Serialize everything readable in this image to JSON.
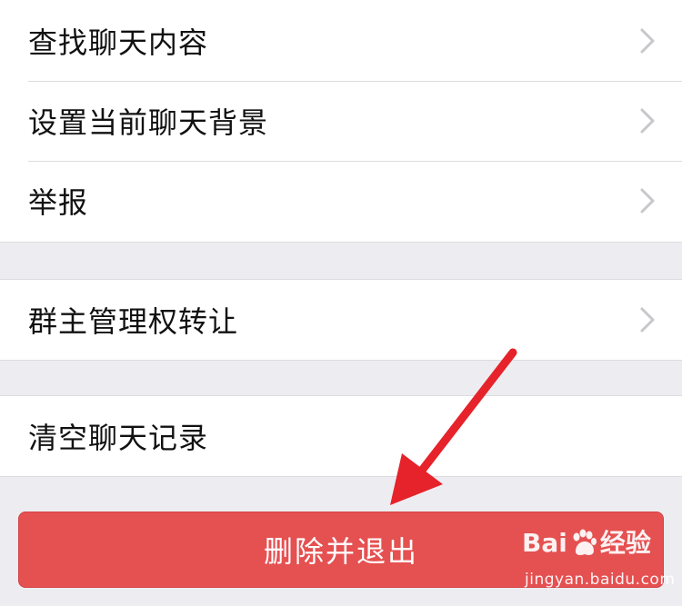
{
  "settings": {
    "group1": [
      {
        "label": "查找聊天内容",
        "has_chevron": true
      },
      {
        "label": "设置当前聊天背景",
        "has_chevron": true
      },
      {
        "label": "举报",
        "has_chevron": true
      }
    ],
    "group2": [
      {
        "label": "群主管理权转让",
        "has_chevron": true
      }
    ],
    "group3": [
      {
        "label": "清空聊天记录",
        "has_chevron": false
      }
    ]
  },
  "actions": {
    "delete_and_exit": "删除并退出"
  },
  "watermark": {
    "brand_left": "Bai",
    "brand_right": "经验",
    "url": "jingyan.baidu.com"
  },
  "colors": {
    "background": "#ededf1",
    "row_background": "#ffffff",
    "danger": "#e55051",
    "annotation_arrow": "#e6222a",
    "chevron": "#c7c7cc"
  },
  "icons": {
    "chevron": "chevron-right-icon",
    "annotation": "red-arrow-annotation",
    "watermark_paw": "baidu-paw-icon"
  }
}
